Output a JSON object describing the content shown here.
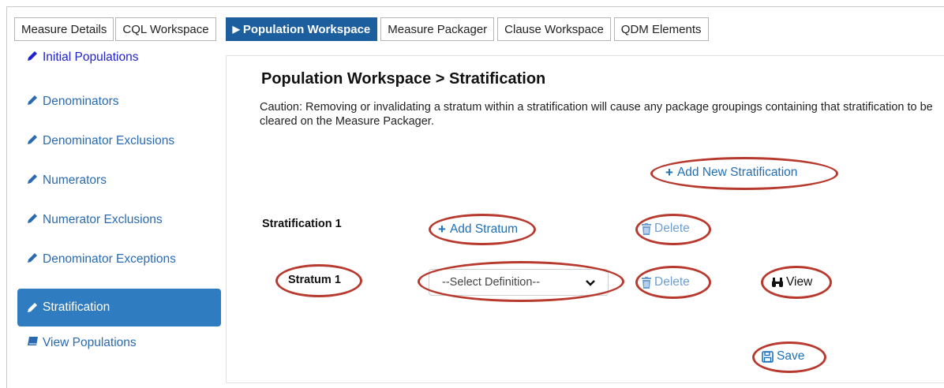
{
  "tabs": [
    {
      "label": "Measure Details"
    },
    {
      "label": "CQL Workspace"
    },
    {
      "label": "Population Workspace",
      "active": true
    },
    {
      "label": "Measure Packager"
    },
    {
      "label": "Clause Workspace"
    },
    {
      "label": "QDM Elements"
    }
  ],
  "sidebar": {
    "items": [
      {
        "label": "Initial Populations",
        "icon": "pencil-icon"
      },
      {
        "label": "Denominators",
        "icon": "pencil-icon"
      },
      {
        "label": "Denominator Exclusions",
        "icon": "pencil-icon"
      },
      {
        "label": "Numerators",
        "icon": "pencil-icon"
      },
      {
        "label": "Numerator Exclusions",
        "icon": "pencil-icon"
      },
      {
        "label": "Denominator Exceptions",
        "icon": "pencil-icon"
      },
      {
        "label": "Stratification",
        "icon": "pencil-icon",
        "active": true
      },
      {
        "label": "View Populations",
        "icon": "book-icon"
      }
    ]
  },
  "main": {
    "title": "Population Workspace > Stratification",
    "caution": "Caution: Removing or invalidating a stratum within a stratification will cause any package groupings containing that stratification to be cleared on the Measure Packager.",
    "add_new_stratification": "Add New Stratification",
    "stratification_label": "Stratification 1",
    "add_stratum": "Add Stratum",
    "delete_label": "Delete",
    "stratum_label": "Stratum 1",
    "select_placeholder": "--Select Definition--",
    "view_label": "View",
    "save_label": "Save"
  },
  "colors": {
    "active_tab": "#1d5f9e",
    "active_sidebar": "#2f7cc1",
    "link": "#1d6fb8",
    "annotation_ring": "#b83a2f"
  }
}
